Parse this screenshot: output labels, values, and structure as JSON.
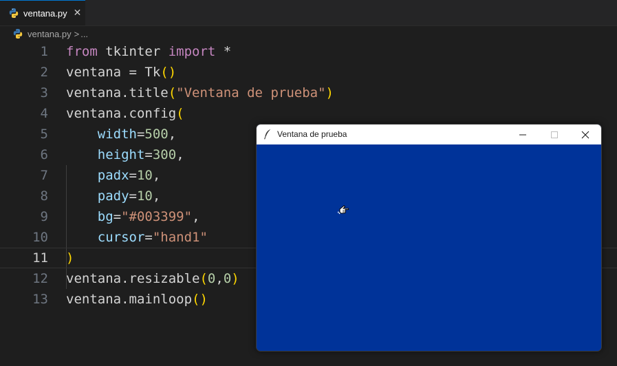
{
  "tab": {
    "label": "ventana.py",
    "close_glyph": "✕",
    "icon": "python-icon"
  },
  "breadcrumb": {
    "file": "ventana.py",
    "separator": ">",
    "more": "..."
  },
  "editor": {
    "current_line": 11,
    "lines": [
      {
        "n": "1",
        "tokens": [
          {
            "t": "from",
            "c": "kw"
          },
          {
            "t": " tkinter ",
            "c": "tx"
          },
          {
            "t": "import",
            "c": "kw"
          },
          {
            "t": " *",
            "c": "tx"
          }
        ]
      },
      {
        "n": "2",
        "tokens": [
          {
            "t": "ventana = Tk",
            "c": "tx"
          },
          {
            "t": "()",
            "c": "brk"
          }
        ]
      },
      {
        "n": "3",
        "tokens": [
          {
            "t": "ventana.title",
            "c": "tx"
          },
          {
            "t": "(",
            "c": "brk"
          },
          {
            "t": "\"Ventana de prueba\"",
            "c": "str"
          },
          {
            "t": ")",
            "c": "brk"
          }
        ]
      },
      {
        "n": "4",
        "tokens": [
          {
            "t": "ventana.config",
            "c": "tx"
          },
          {
            "t": "(",
            "c": "brk"
          }
        ]
      },
      {
        "n": "5",
        "tokens": [
          {
            "t": "    ",
            "c": "tx"
          },
          {
            "t": "width",
            "c": "prm"
          },
          {
            "t": "=",
            "c": "tx"
          },
          {
            "t": "500",
            "c": "num"
          },
          {
            "t": ",",
            "c": "tx"
          }
        ]
      },
      {
        "n": "6",
        "tokens": [
          {
            "t": "    ",
            "c": "tx"
          },
          {
            "t": "height",
            "c": "prm"
          },
          {
            "t": "=",
            "c": "tx"
          },
          {
            "t": "300",
            "c": "num"
          },
          {
            "t": ",",
            "c": "tx"
          }
        ]
      },
      {
        "n": "7",
        "tokens": [
          {
            "t": "    ",
            "c": "tx"
          },
          {
            "t": "padx",
            "c": "prm"
          },
          {
            "t": "=",
            "c": "tx"
          },
          {
            "t": "10",
            "c": "num"
          },
          {
            "t": ",",
            "c": "tx"
          }
        ]
      },
      {
        "n": "8",
        "tokens": [
          {
            "t": "    ",
            "c": "tx"
          },
          {
            "t": "pady",
            "c": "prm"
          },
          {
            "t": "=",
            "c": "tx"
          },
          {
            "t": "10",
            "c": "num"
          },
          {
            "t": ",",
            "c": "tx"
          }
        ]
      },
      {
        "n": "9",
        "tokens": [
          {
            "t": "    ",
            "c": "tx"
          },
          {
            "t": "bg",
            "c": "prm"
          },
          {
            "t": "=",
            "c": "tx"
          },
          {
            "t": "\"#003399\"",
            "c": "str"
          },
          {
            "t": ",",
            "c": "tx"
          }
        ]
      },
      {
        "n": "10",
        "tokens": [
          {
            "t": "    ",
            "c": "tx"
          },
          {
            "t": "cursor",
            "c": "prm"
          },
          {
            "t": "=",
            "c": "tx"
          },
          {
            "t": "\"hand1\"",
            "c": "str"
          }
        ]
      },
      {
        "n": "11",
        "tokens": [
          {
            "t": ")",
            "c": "brk"
          }
        ]
      },
      {
        "n": "12",
        "tokens": [
          {
            "t": "ventana.resizable",
            "c": "tx"
          },
          {
            "t": "(",
            "c": "brk"
          },
          {
            "t": "0",
            "c": "num"
          },
          {
            "t": ",",
            "c": "tx"
          },
          {
            "t": "0",
            "c": "num"
          },
          {
            "t": ")",
            "c": "brk"
          }
        ]
      },
      {
        "n": "13",
        "tokens": [
          {
            "t": "ventana.mainloop",
            "c": "tx"
          },
          {
            "t": "()",
            "c": "brk"
          }
        ]
      }
    ]
  },
  "tk_window": {
    "title": "Ventana de prueba",
    "icon": "feather-icon",
    "background": "#003399",
    "cursor_icon": "hand-pointer-icon",
    "controls": {
      "minimize": "minimize-icon",
      "maximize": "maximize-icon",
      "close": "close-icon"
    }
  },
  "colors": {
    "editor_bg": "#1e1e1e",
    "keyword": "#c586c0",
    "string": "#ce9178",
    "number": "#b5cea8",
    "parameter": "#9cdcfe",
    "bracket": "#ffd700",
    "text": "#d4d4d4",
    "tab_accent": "#0078d4"
  }
}
